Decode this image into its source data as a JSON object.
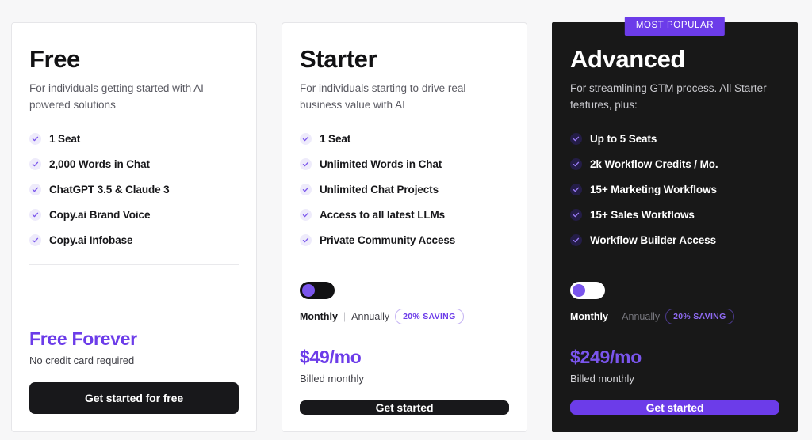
{
  "plans": [
    {
      "id": "free",
      "theme": "light",
      "name": "Free",
      "description": "For individuals getting started with AI powered solutions",
      "features": [
        "1 Seat",
        "2,000 Words in Chat",
        "ChatGPT 3.5 & Claude 3",
        "Copy.ai Brand Voice",
        "Copy.ai Infobase"
      ],
      "has_billing_toggle": false,
      "price": "Free Forever",
      "price_sub": "No credit card required",
      "cta_label": "Get started for free",
      "cta_style": "black",
      "badge": null
    },
    {
      "id": "starter",
      "theme": "light",
      "name": "Starter",
      "description": "For individuals starting to drive real business value with AI",
      "features": [
        "1 Seat",
        "Unlimited Words in Chat",
        "Unlimited Chat Projects",
        "Access to all latest LLMs",
        "Private Community Access"
      ],
      "has_billing_toggle": true,
      "billing": {
        "monthly_label": "Monthly",
        "separator": "|",
        "annually_label": "Annually",
        "saving_label": "20% SAVING",
        "selected": "Monthly"
      },
      "price": "$49/mo",
      "price_sub": "Billed monthly",
      "cta_label": "Get started",
      "cta_style": "black",
      "badge": null
    },
    {
      "id": "advanced",
      "theme": "dark",
      "name": "Advanced",
      "description": "For streamlining GTM process. All Starter features, plus:",
      "features": [
        "Up to 5 Seats",
        "2k Workflow Credits / Mo.",
        "15+ Marketing Workflows",
        "15+ Sales Workflows",
        "Workflow Builder Access"
      ],
      "has_billing_toggle": true,
      "billing": {
        "monthly_label": "Monthly",
        "separator": "|",
        "annually_label": "Annually",
        "saving_label": "20% SAVING",
        "selected": "Monthly"
      },
      "price": "$249/mo",
      "price_sub": "Billed monthly",
      "cta_label": "Get started",
      "cta_style": "purple",
      "badge": "MOST POPULAR"
    }
  ],
  "colors": {
    "accent_purple": "#6c3ce9",
    "toggle_knob": "#7a55ec",
    "dark_card_bg": "#181818",
    "page_bg": "#f7f7f8",
    "check_bg_light": "#eeebfb",
    "check_bg_dark": "#241d47"
  }
}
